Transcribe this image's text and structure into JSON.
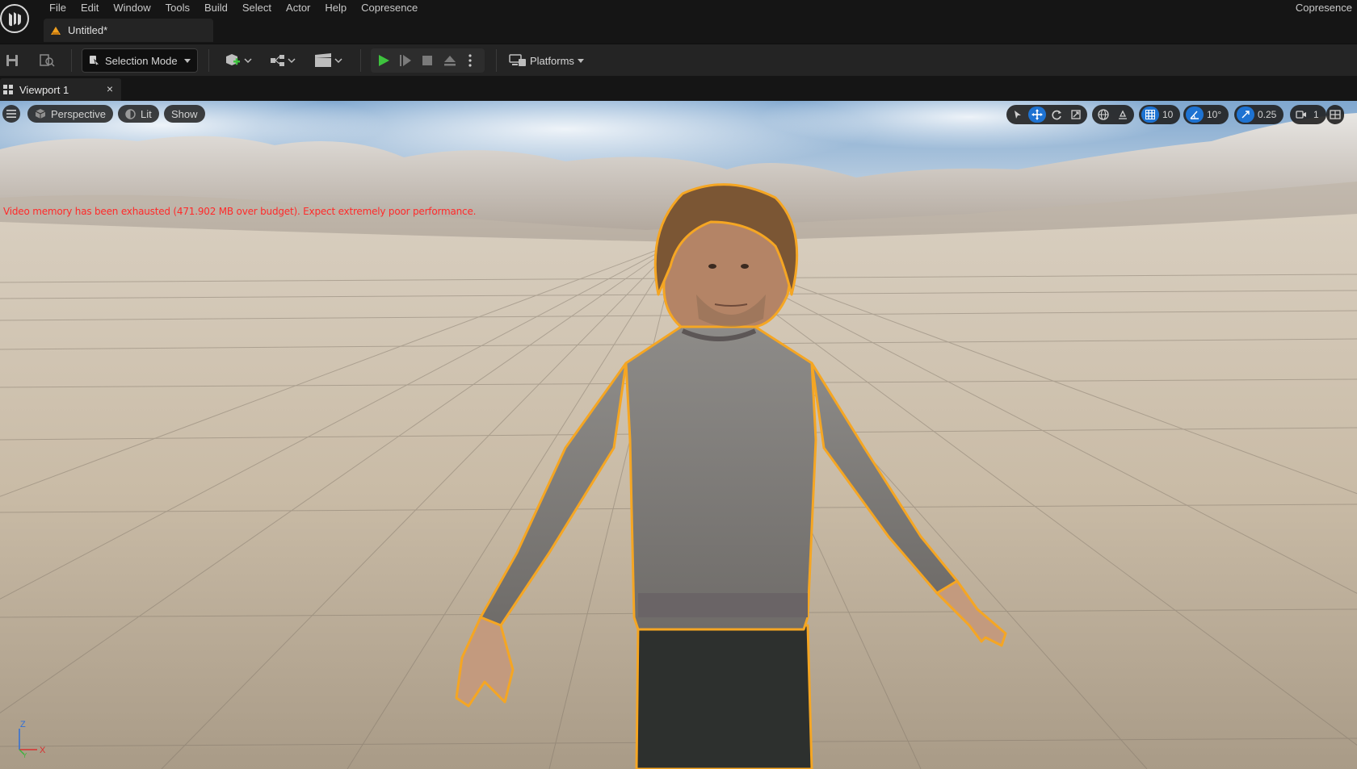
{
  "app": {
    "name": "Copresence",
    "logo": "unreal-engine-logo"
  },
  "menu": [
    "File",
    "Edit",
    "Window",
    "Tools",
    "Build",
    "Select",
    "Actor",
    "Help",
    "Copresence"
  ],
  "document_tab": {
    "title": "Untitled*",
    "icon": "level-icon"
  },
  "toolbar": {
    "selection_mode": "Selection Mode",
    "platforms": "Platforms",
    "icons": [
      "save-icon",
      "browse-icon",
      "add-actor-icon",
      "blueprint-icon",
      "cinematics-icon",
      "play-icon",
      "advance-frame-icon",
      "stop-icon",
      "eject-icon",
      "more-options-icon",
      "platforms-icon"
    ]
  },
  "viewport_tab": {
    "title": "Viewport 1",
    "close": "×"
  },
  "viewport": {
    "perspective": "Perspective",
    "lit": "Lit",
    "show": "Show",
    "grid_snap": "10",
    "rotation_snap": "10°",
    "scale_snap": "0.25",
    "camera_speed": "1",
    "warning": "Video memory has been exhausted (471.902 MB over budget). Expect extremely poor performance.",
    "axis_labels": {
      "z": "Z",
      "x": "X",
      "y": "Y"
    }
  },
  "colors": {
    "selection_outline": "#f5a623",
    "accent": "#1e73d2",
    "play": "#3ec33e",
    "warning": "#ff2a2a"
  }
}
